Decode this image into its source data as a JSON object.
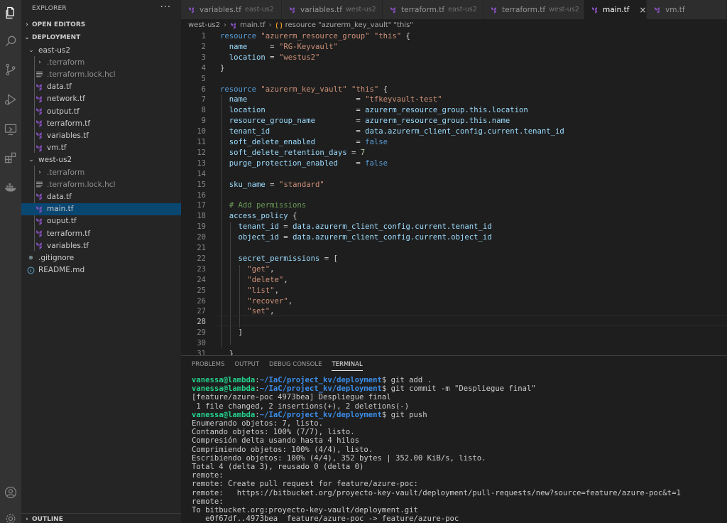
{
  "activity_bar": {
    "top_icons": [
      "files-icon",
      "search-icon",
      "source-control-icon",
      "run-debug-icon",
      "remote-explorer-icon",
      "extensions-icon",
      "docker-icon"
    ],
    "bottom_icons": [
      "account-icon",
      "settings-gear-icon"
    ]
  },
  "sidebar": {
    "title": "EXPLORER",
    "more": "···",
    "open_editors": "OPEN EDITORS",
    "deployment": "DEPLOYMENT",
    "outline": "OUTLINE",
    "tree": [
      {
        "label": "east-us2",
        "kind": "folder-open",
        "depth": 1
      },
      {
        "label": ".terraform",
        "kind": "folder-closed",
        "depth": 2,
        "dim": true
      },
      {
        "label": ".terraform.lock.hcl",
        "kind": "lines-file",
        "depth": 2,
        "dim": true
      },
      {
        "label": "data.tf",
        "kind": "terraform-file",
        "depth": 2
      },
      {
        "label": "network.tf",
        "kind": "terraform-file",
        "depth": 2
      },
      {
        "label": "output.tf",
        "kind": "terraform-file",
        "depth": 2
      },
      {
        "label": "terraform.tf",
        "kind": "terraform-file",
        "depth": 2
      },
      {
        "label": "variables.tf",
        "kind": "terraform-file",
        "depth": 2
      },
      {
        "label": "vm.tf",
        "kind": "terraform-file",
        "depth": 2
      },
      {
        "label": "west-us2",
        "kind": "folder-open",
        "depth": 1
      },
      {
        "label": ".terraform",
        "kind": "folder-closed",
        "depth": 2,
        "dim": true
      },
      {
        "label": ".terraform.lock.hcl",
        "kind": "lines-file",
        "depth": 2,
        "dim": true
      },
      {
        "label": "data.tf",
        "kind": "terraform-file",
        "depth": 2
      },
      {
        "label": "main.tf",
        "kind": "terraform-file",
        "depth": 2,
        "selected": true
      },
      {
        "label": "ouput.tf",
        "kind": "terraform-file",
        "depth": 2
      },
      {
        "label": "terraform.tf",
        "kind": "terraform-file",
        "depth": 2
      },
      {
        "label": "variables.tf",
        "kind": "terraform-file",
        "depth": 2
      },
      {
        "label": ".gitignore",
        "kind": "gitignore-file",
        "depth": 1
      },
      {
        "label": "README.md",
        "kind": "info-file",
        "depth": 1
      }
    ]
  },
  "tabs": [
    {
      "label": "variables.tf",
      "desc": "east-us2"
    },
    {
      "label": "variables.tf",
      "desc": "west-us2"
    },
    {
      "label": "terraform.tf",
      "desc": "east-us2"
    },
    {
      "label": "terraform.tf",
      "desc": "west-us2"
    },
    {
      "label": "main.tf",
      "desc": "",
      "active": true,
      "close": "×"
    },
    {
      "label": "vm.tf",
      "desc": ""
    }
  ],
  "breadcrumb": {
    "folder": "west-us2",
    "file": "main.tf",
    "symbol": "resource \"azurerm_key_vault\" \"this\""
  },
  "editor": {
    "current_line": 28,
    "line_numbers": [
      "1",
      "2",
      "3",
      "4",
      "5",
      "6",
      "7",
      "8",
      "9",
      "10",
      "11",
      "12",
      "13",
      "14",
      "15",
      "16",
      "17",
      "18",
      "19",
      "20",
      "21",
      "22",
      "23",
      "24",
      "25",
      "26",
      "27",
      "28",
      "29",
      "30",
      "31"
    ],
    "lines": [
      "resource \"azurerm_resource_group\" \"this\" {",
      "  name     = \"RG-Keyvault\"",
      "  location = \"westus2\"",
      "}",
      "",
      "resource \"azurerm_key_vault\" \"this\" {",
      "  name                        = \"tfkeyvault-test\"",
      "  location                    = azurerm_resource_group.this.location",
      "  resource_group_name         = azurerm_resource_group.this.name",
      "  tenant_id                   = data.azurerm_client_config.current.tenant_id",
      "  soft_delete_enabled         = false",
      "  soft_delete_retention_days = 7",
      "  purge_protection_enabled    = false",
      "",
      "  sku_name = \"standard\"",
      "",
      "  # Add permissions",
      "  access_policy {",
      "    tenant_id = data.azurerm_client_config.current.tenant_id",
      "    object_id = data.azurerm_client_config.current.object_id",
      "",
      "    secret_permissions = [",
      "      \"get\",",
      "      \"delete\",",
      "      \"list\",",
      "      \"recover\",",
      "      \"set\",",
      "",
      "    ]",
      "",
      "  }"
    ]
  },
  "panel": {
    "tabs": [
      "PROBLEMS",
      "OUTPUT",
      "DEBUG CONSOLE",
      "TERMINAL"
    ],
    "active_tab": "TERMINAL",
    "terminal": {
      "user": "vanessa@lambda",
      "path": "~/IaC/project_kv/deployment",
      "cmd1": "$ git add .",
      "cmd2": "$ git commit -m \"Despliegue final\"",
      "out1": "[feature/azure-poc 4973bea] Despliegue final",
      "out2": " 1 file changed, 2 insertions(+), 2 deletions(-)",
      "cmd3": "$ git push",
      "lines": [
        "Enumerando objetos: 7, listo.",
        "Contando objetos: 100% (7/7), listo.",
        "Compresión delta usando hasta 4 hilos",
        "Comprimiendo objetos: 100% (4/4), listo.",
        "Escribiendo objetos: 100% (4/4), 352 bytes | 352.00 KiB/s, listo.",
        "Total 4 (delta 3), reusado 0 (delta 0)",
        "remote:",
        "remote: Create pull request for feature/azure-poc:",
        "remote:   https://bitbucket.org/proyecto-key-vault/deployment/pull-requests/new?source=feature/azure-poc&t=1",
        "remote:",
        "To bitbucket.org:proyecto-key-vault/deployment.git",
        "   e0f67df..4973bea  feature/azure-poc -> feature/azure-poc"
      ]
    }
  },
  "colors": {
    "terraform_icon": "#844fba",
    "selection": "#094771",
    "accent": "#007acc"
  }
}
